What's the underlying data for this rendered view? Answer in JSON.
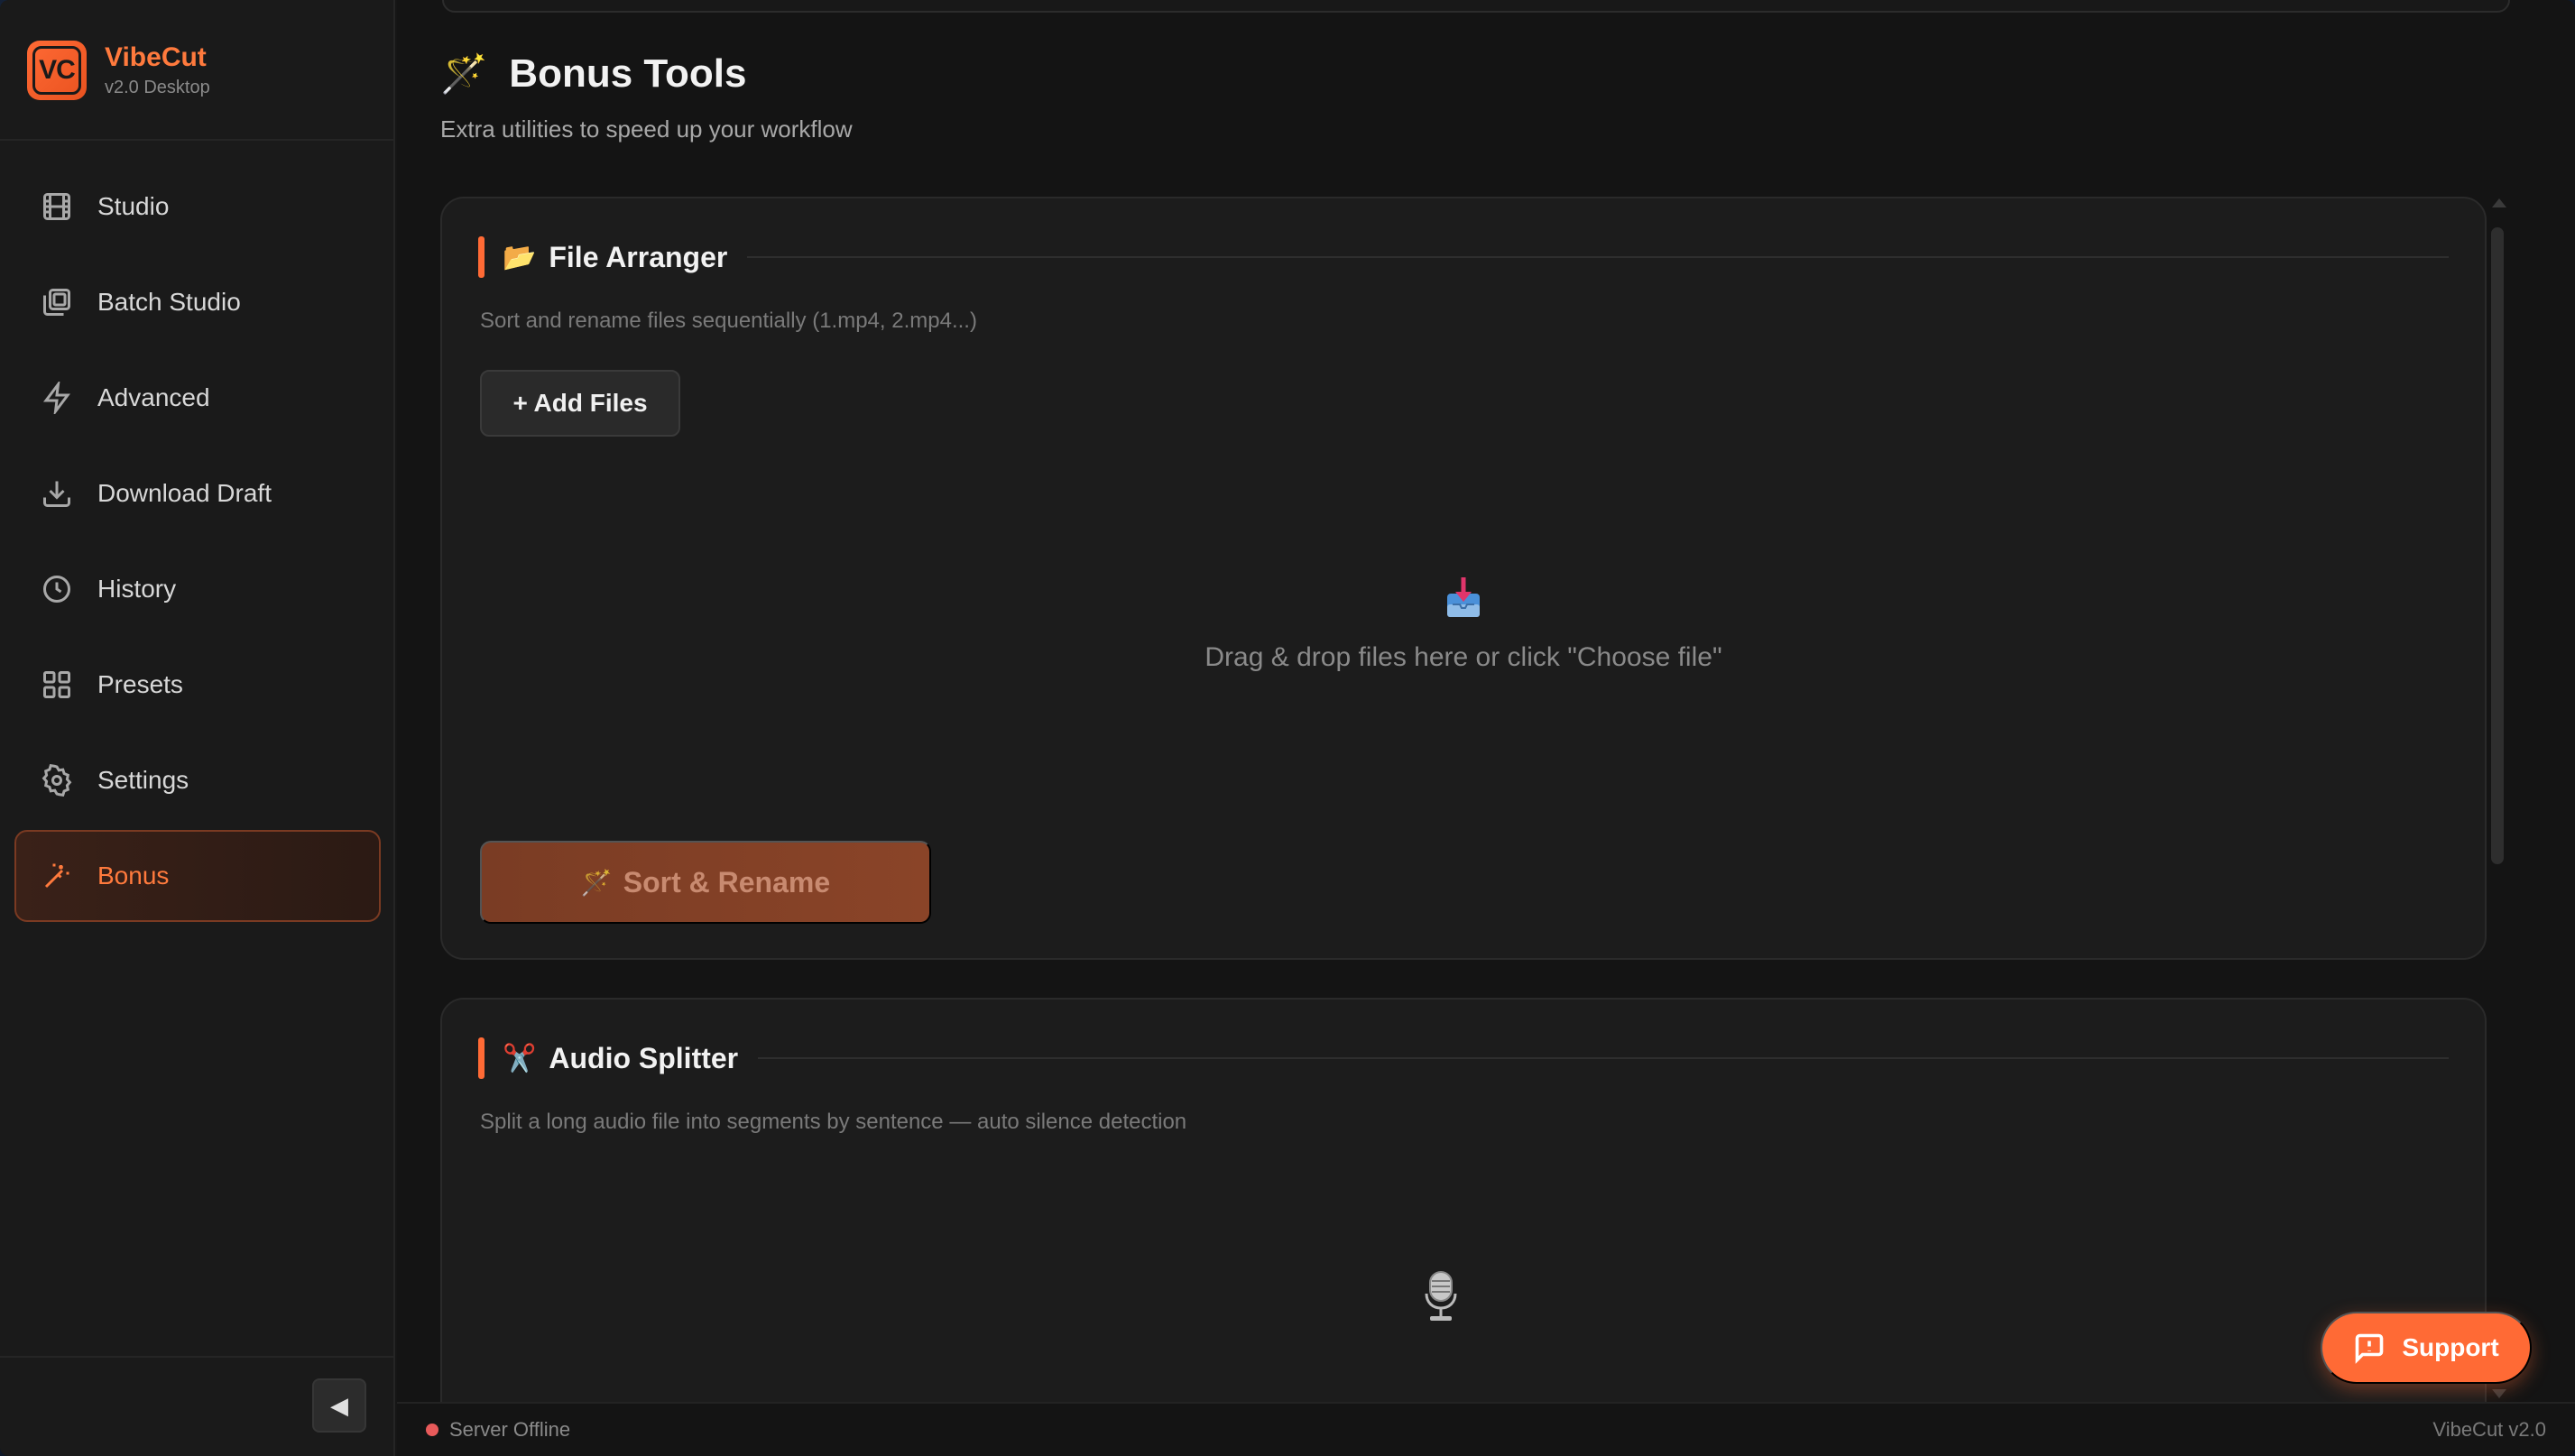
{
  "app": {
    "name": "VibeCut",
    "logo_text": "VC",
    "version_label": "v2.0 Desktop",
    "accent_color": "#ff6a35"
  },
  "sidebar": {
    "items": [
      {
        "label": "Studio",
        "icon": "film-icon"
      },
      {
        "label": "Batch Studio",
        "icon": "layers-icon"
      },
      {
        "label": "Advanced",
        "icon": "lightning-icon"
      },
      {
        "label": "Download Draft",
        "icon": "download-icon"
      },
      {
        "label": "History",
        "icon": "clock-icon"
      },
      {
        "label": "Presets",
        "icon": "grid-icon"
      },
      {
        "label": "Settings",
        "icon": "gear-icon"
      },
      {
        "label": "Bonus",
        "icon": "magic-wand-icon",
        "active": true
      }
    ],
    "collapse_glyph": "◀"
  },
  "page": {
    "title_emoji": "🪄",
    "title": "Bonus Tools",
    "subtitle": "Extra utilities to speed up your workflow"
  },
  "file_arranger": {
    "emoji": "📂",
    "title": "File Arranger",
    "description": "Sort and rename files sequentially (1.mp4, 2.mp4...)",
    "add_files_label": "+ Add Files",
    "drop_text": "Drag & drop files here or click \"Choose file\"",
    "sort_button_emoji": "🪄",
    "sort_button_label": "Sort & Rename"
  },
  "audio_splitter": {
    "emoji": "✂️",
    "title": "Audio Splitter",
    "description": "Split a long audio file into segments by sentence — auto silence detection"
  },
  "support": {
    "label": "Support"
  },
  "status": {
    "server": "Server Offline",
    "server_color": "#e85a5a",
    "app_version": "VibeCut v2.0"
  }
}
